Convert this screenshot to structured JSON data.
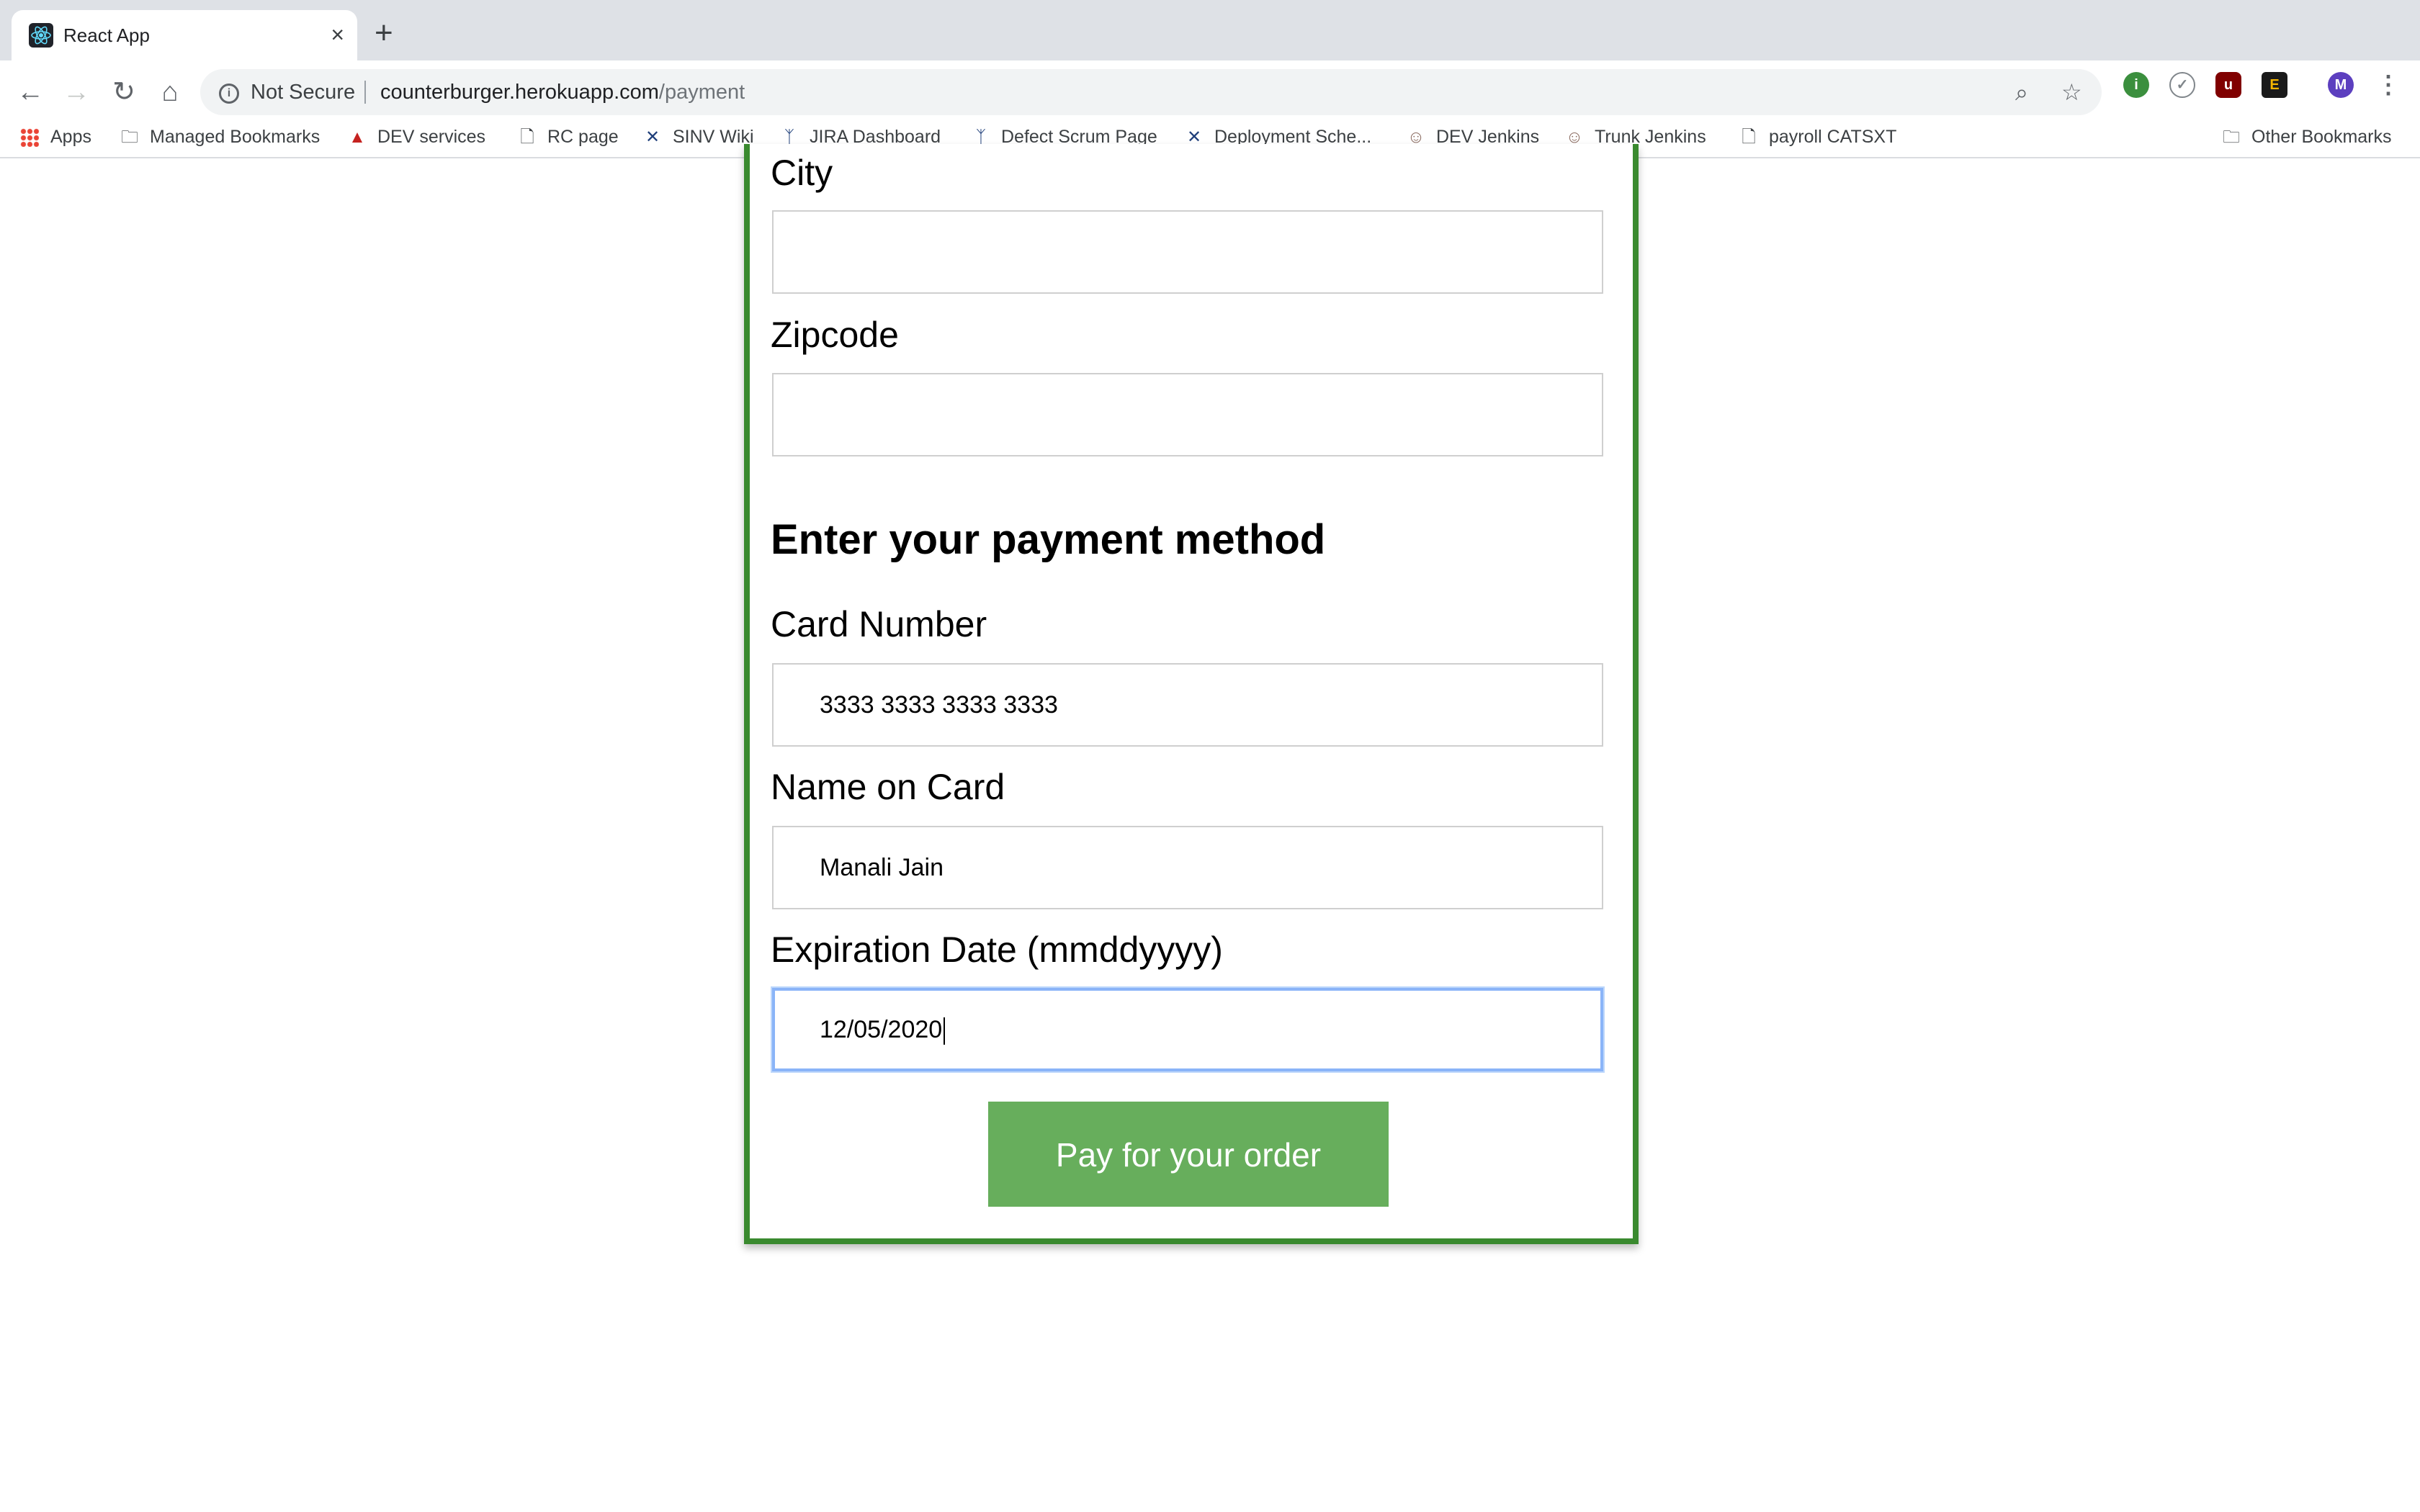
{
  "browser": {
    "tab_title": "React App",
    "close_glyph": "×",
    "new_tab_glyph": "+",
    "security_label": "Not Secure",
    "url_host": "counterburger.herokuapp.com",
    "url_path": "/payment",
    "profile_initial": "M",
    "bookmarks": [
      {
        "label": "Apps",
        "icon": "apps-grid-icon"
      },
      {
        "label": "Managed Bookmarks",
        "icon": "folder-icon"
      },
      {
        "label": "DEV services",
        "icon": "cloud-icon"
      },
      {
        "label": "RC page",
        "icon": "page-icon"
      },
      {
        "label": "SINV Wiki",
        "icon": "confluence-icon"
      },
      {
        "label": "JIRA Dashboard",
        "icon": "jira-icon"
      },
      {
        "label": "Defect Scrum Page",
        "icon": "jira-icon"
      },
      {
        "label": "Deployment Sche...",
        "icon": "confluence-icon"
      },
      {
        "label": "DEV Jenkins",
        "icon": "jenkins-icon"
      },
      {
        "label": "Trunk Jenkins",
        "icon": "jenkins-icon"
      },
      {
        "label": "payroll CATSXT",
        "icon": "page-icon"
      }
    ],
    "other_bookmarks": "Other Bookmarks"
  },
  "form": {
    "city_label": "City",
    "city_value": "",
    "zipcode_label": "Zipcode",
    "zipcode_value": "",
    "payment_heading": "Enter your payment method",
    "card_number_label": "Card Number",
    "card_number_value": "3333 3333 3333 3333",
    "name_label": "Name on Card",
    "name_value": "Manali Jain",
    "expiration_label": "Expiration Date (mmddyyyy)",
    "expiration_value": "12/05/2020",
    "submit_label": "Pay for your order"
  },
  "colors": {
    "card_border": "#3a8a2f",
    "button_bg": "#67ae5c",
    "focus_ring": "#8ab4f8"
  }
}
